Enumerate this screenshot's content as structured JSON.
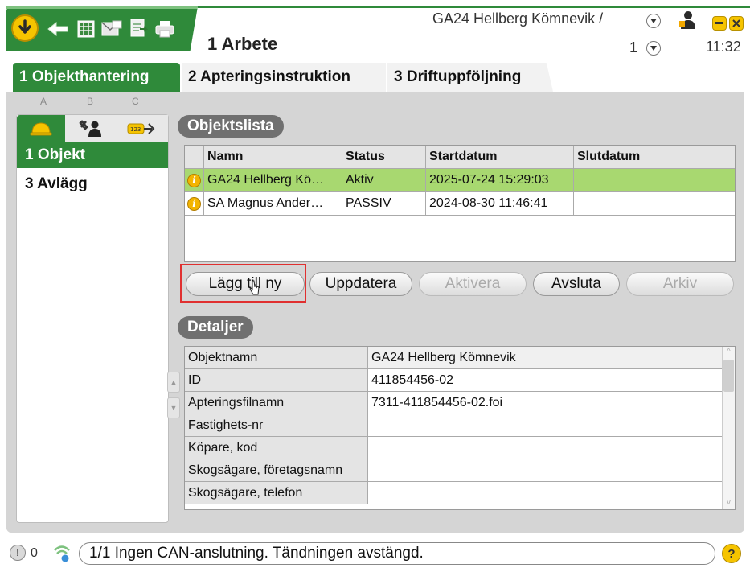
{
  "header": {
    "view_title": "1 Arbete",
    "user": "GA24 Hellberg Kömnevik /",
    "page": "1",
    "clock": "11:32"
  },
  "main_tabs": [
    {
      "label": "1 Objekthantering",
      "active": true
    },
    {
      "label": "2 Apteringsinstruktion",
      "active": false
    },
    {
      "label": "3 Driftuppföljning",
      "active": false
    }
  ],
  "nav": {
    "column_letters": [
      "A",
      "B",
      "C"
    ],
    "icons": [
      "helmet-icon",
      "operator-tools-icon",
      "meter-tag-icon"
    ],
    "items": [
      {
        "label": "1 Objekt",
        "active": true
      },
      {
        "label": "3 Avlägg",
        "active": false
      }
    ]
  },
  "object_list": {
    "title": "Objektslista",
    "columns": [
      "",
      "Namn",
      "Status",
      "Startdatum",
      "Slutdatum"
    ],
    "rows": [
      {
        "name": "GA24 Hellberg Kö…",
        "status": "Aktiv",
        "start": "2025-07-24 15:29:03",
        "end": "",
        "selected": true
      },
      {
        "name": "SA Magnus Ander…",
        "status": "PASSIV",
        "start": "2024-08-30 11:46:41",
        "end": "",
        "selected": false
      }
    ]
  },
  "buttons": {
    "add": "Lägg till ny",
    "update": "Uppdatera",
    "activate": "Aktivera",
    "end": "Avsluta",
    "archive": "Arkiv"
  },
  "details": {
    "title": "Detaljer",
    "rows": [
      {
        "key": "Objektnamn",
        "value": "GA24 Hellberg Kömnevik"
      },
      {
        "key": "ID",
        "value": "411854456-02"
      },
      {
        "key": "Apteringsfilnamn",
        "value": "7311-411854456-02.foi"
      },
      {
        "key": "Fastighets-nr",
        "value": ""
      },
      {
        "key": "Köpare, kod",
        "value": ""
      },
      {
        "key": "Skogsägare, företagsnamn",
        "value": ""
      },
      {
        "key": "Skogsägare, telefon",
        "value": ""
      }
    ]
  },
  "status": {
    "alarm_count": "0",
    "message": "1/1 Ingen CAN-anslutning. Tändningen avstängd.",
    "help": "?"
  },
  "colors": {
    "accent_green": "#2f8a3a",
    "selected_row": "#a8d870",
    "warning_yellow": "#f6c400"
  }
}
